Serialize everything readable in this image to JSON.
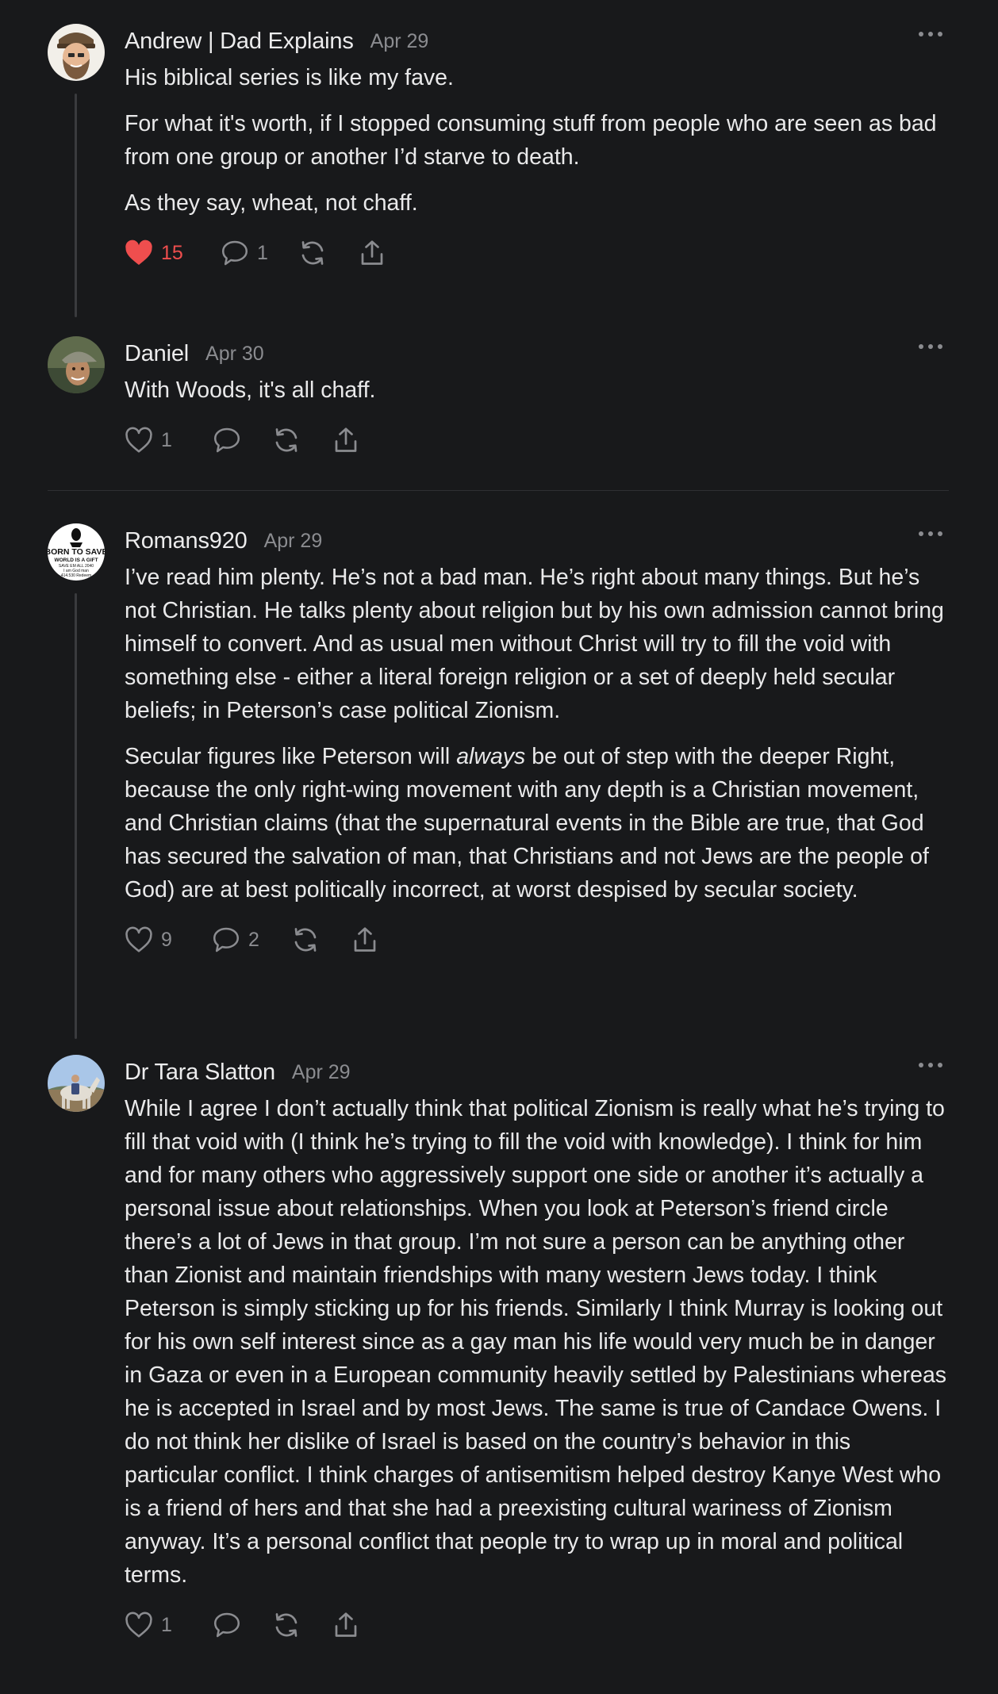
{
  "comments": [
    {
      "author": "Andrew | Dad Explains",
      "date": "Apr 29",
      "avatar_icon": "bearded-man-avatar",
      "paragraphs": [
        "His biblical series is like my fave.",
        "For what it's worth, if I stopped consuming stuff from people who are seen as bad from one group or another I’d starve to death.",
        "As they say, wheat, not chaff."
      ],
      "likes": "15",
      "liked": true,
      "replies": "1"
    },
    {
      "author": "Daniel",
      "date": "Apr 30",
      "avatar_icon": "man-in-cap-avatar",
      "paragraphs": [
        "With Woods, it's all chaff."
      ],
      "likes": "1",
      "liked": false,
      "replies": ""
    },
    {
      "author": "Romans920",
      "date": "Apr 29",
      "avatar_icon": "born-to-save-logo-avatar",
      "avatar_text": [
        "BORN TO SAVE",
        "WORLD IS A GIFT",
        "SAVE EM ALL 2040",
        "I am God man",
        "414.530 Redeem"
      ],
      "paragraphs": [
        "I’ve read him plenty. He’s not a bad man. He’s right about many things. But he’s not Christian. He talks plenty about religion but by his own admission cannot bring himself to convert. And as usual men without Christ will try to fill the void with something else - either a literal foreign religion or a set of deeply held secular beliefs; in Peterson’s case political Zionism."
      ],
      "p2_before": "Secular figures like Peterson will ",
      "p2_em": "always",
      "p2_after": " be out of step with the deeper Right, because the only right-wing movement with any depth is a Christian movement, and Christian claims (that the supernatural events in the Bible are true, that God has secured the salvation of man, that Christians and not Jews are the people of God) are at best politically incorrect, at worst despised by secular society.",
      "likes": "9",
      "liked": false,
      "replies": "2"
    },
    {
      "author": "Dr Tara Slatton",
      "date": "Apr 29",
      "avatar_icon": "horse-rider-avatar",
      "paragraphs": [
        "While I agree I don’t actually think that political Zionism is really what he’s trying to fill that void with (I think he’s trying to fill the void with knowledge). I think for him and for many others who aggressively support one side or another it’s actually a personal issue about relationships. When you look at Peterson’s friend circle there’s a lot of Jews in that group. I’m not sure a person can be anything other than Zionist and maintain friendships with many western Jews today. I think Peterson is simply sticking up for his friends. Similarly I think Murray is looking out for his own self interest since as a gay man his life would very much be in danger in Gaza or even in a European community heavily settled by Palestinians whereas he is accepted in Israel and by most Jews. The same is true of Candace Owens. I do not think her dislike of Israel is based on the country’s behavior in this particular conflict. I think charges of antisemitism helped destroy Kanye West who is a friend of hers and that she had a preexisting cultural wariness of Zionism anyway. It’s a personal conflict that people try to wrap up in moral and political terms."
      ],
      "likes": "1",
      "liked": false,
      "replies": ""
    }
  ],
  "colors": {
    "background": "#18191b",
    "text": "#e9e9ea",
    "muted": "#8b8c90",
    "like_active": "#ef4e4e",
    "thread_line": "#3a3b3e"
  }
}
